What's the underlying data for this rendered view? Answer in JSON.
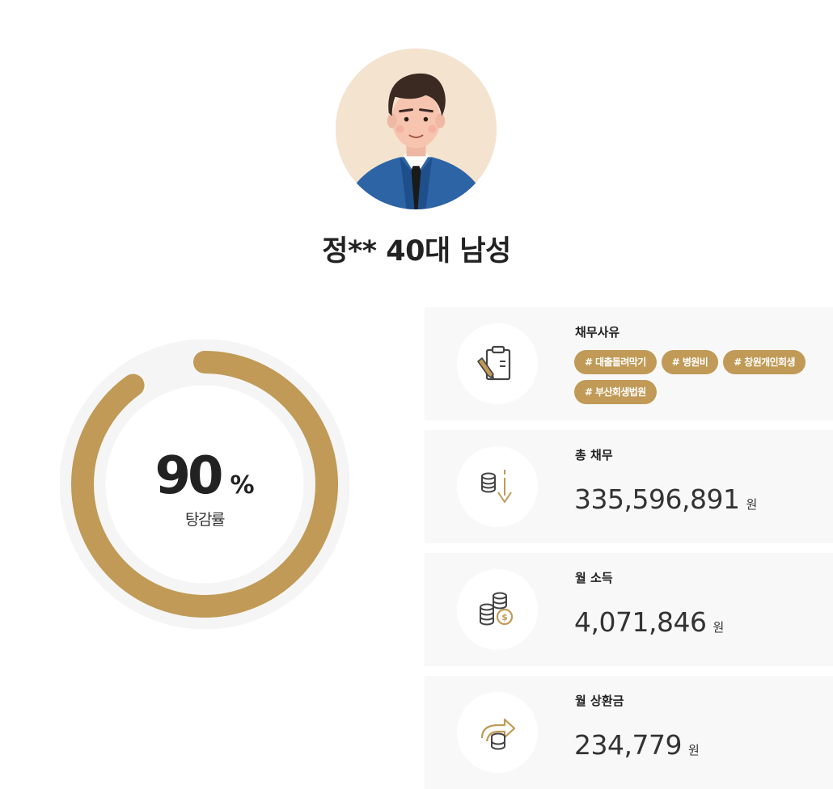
{
  "profile": {
    "name": "정** 40대 남성"
  },
  "reduction": {
    "value": "90",
    "unit": "%",
    "label": "탕감률",
    "percent": 90,
    "color": "#c09a56",
    "track_color": "#f5f5f5"
  },
  "cards": {
    "reason": {
      "title": "채무사유",
      "icon": "clipboard-pencil-icon",
      "tags": [
        "# 대출돌려막기",
        "# 병원비",
        "# 창원개인회생",
        "# 부산회생법원"
      ]
    },
    "total_debt": {
      "title": "총 채무",
      "icon": "coins-arrow-down-icon",
      "value": "335,596,891",
      "unit": "원"
    },
    "monthly_income": {
      "title": "월 소득",
      "icon": "coin-stacks-icon",
      "value": "4,071,846",
      "unit": "원"
    },
    "monthly_payment": {
      "title": "월 상환금",
      "icon": "coins-exchange-arrow-icon",
      "value": "234,779",
      "unit": "원"
    }
  },
  "colors": {
    "accent": "#c09a56",
    "card_bg": "#f8f8f8",
    "text": "#222222"
  }
}
